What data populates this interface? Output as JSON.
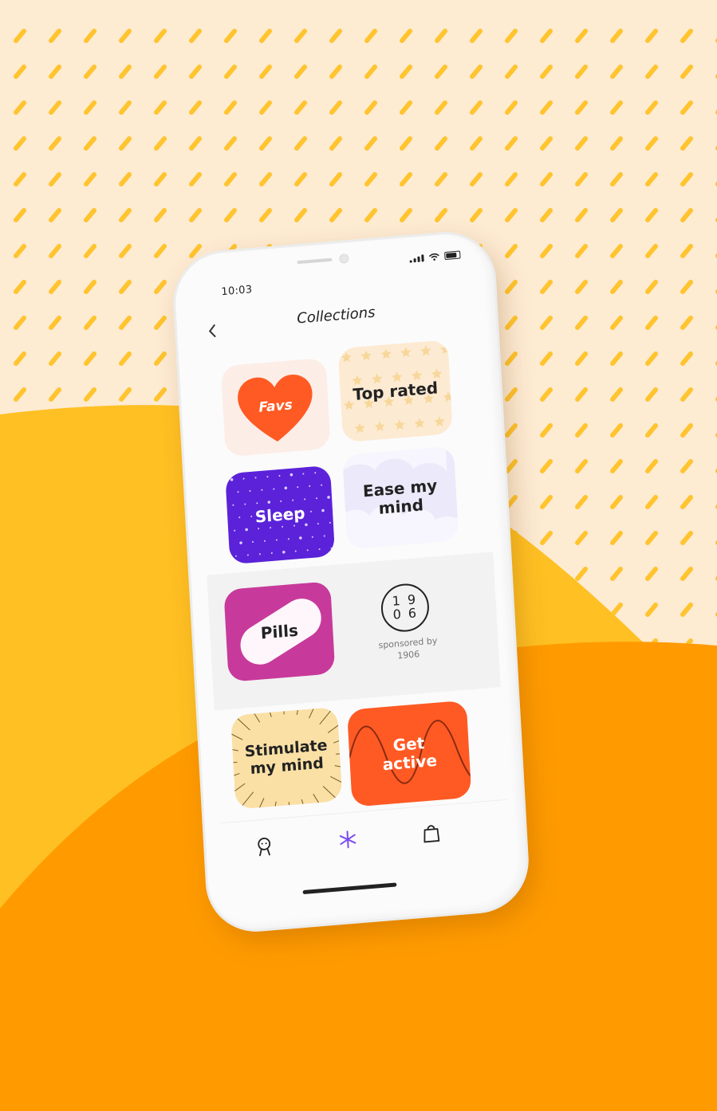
{
  "colors": {
    "background": "#FDEBD2",
    "dash": "#FFC42E",
    "hill_light": "#FFC023",
    "hill_dark": "#FF9B00",
    "favs": "#FF5A23",
    "sleep": "#5B22D9",
    "pills": "#C73A9B",
    "active": "#FF5A23",
    "accent": "#7A4CF0"
  },
  "status": {
    "time": "10:03"
  },
  "header": {
    "title": "Collections",
    "back_icon": "chevron-left-icon"
  },
  "collections": [
    {
      "label": "Favs",
      "icon": "heart-icon"
    },
    {
      "label": "Top rated",
      "icon": "stars-pattern"
    },
    {
      "label": "Sleep",
      "icon": "night-sky-pattern"
    },
    {
      "label": "Ease my mind",
      "icon": "clouds-pattern"
    },
    {
      "label": "Pills",
      "icon": "pill-shape"
    },
    {
      "label": "Stimulate my mind",
      "icon": "sunburst-pattern"
    },
    {
      "label": "Get active",
      "icon": "wave-pattern"
    }
  ],
  "sponsor": {
    "logo_top": "1 9",
    "logo_bottom": "0 6",
    "text_line1": "sponsored by",
    "text_line2": "1906"
  },
  "tabbar": {
    "items": [
      {
        "icon": "profile-icon"
      },
      {
        "icon": "asterisk-icon",
        "active": true
      },
      {
        "icon": "shopping-bag-icon"
      }
    ]
  }
}
